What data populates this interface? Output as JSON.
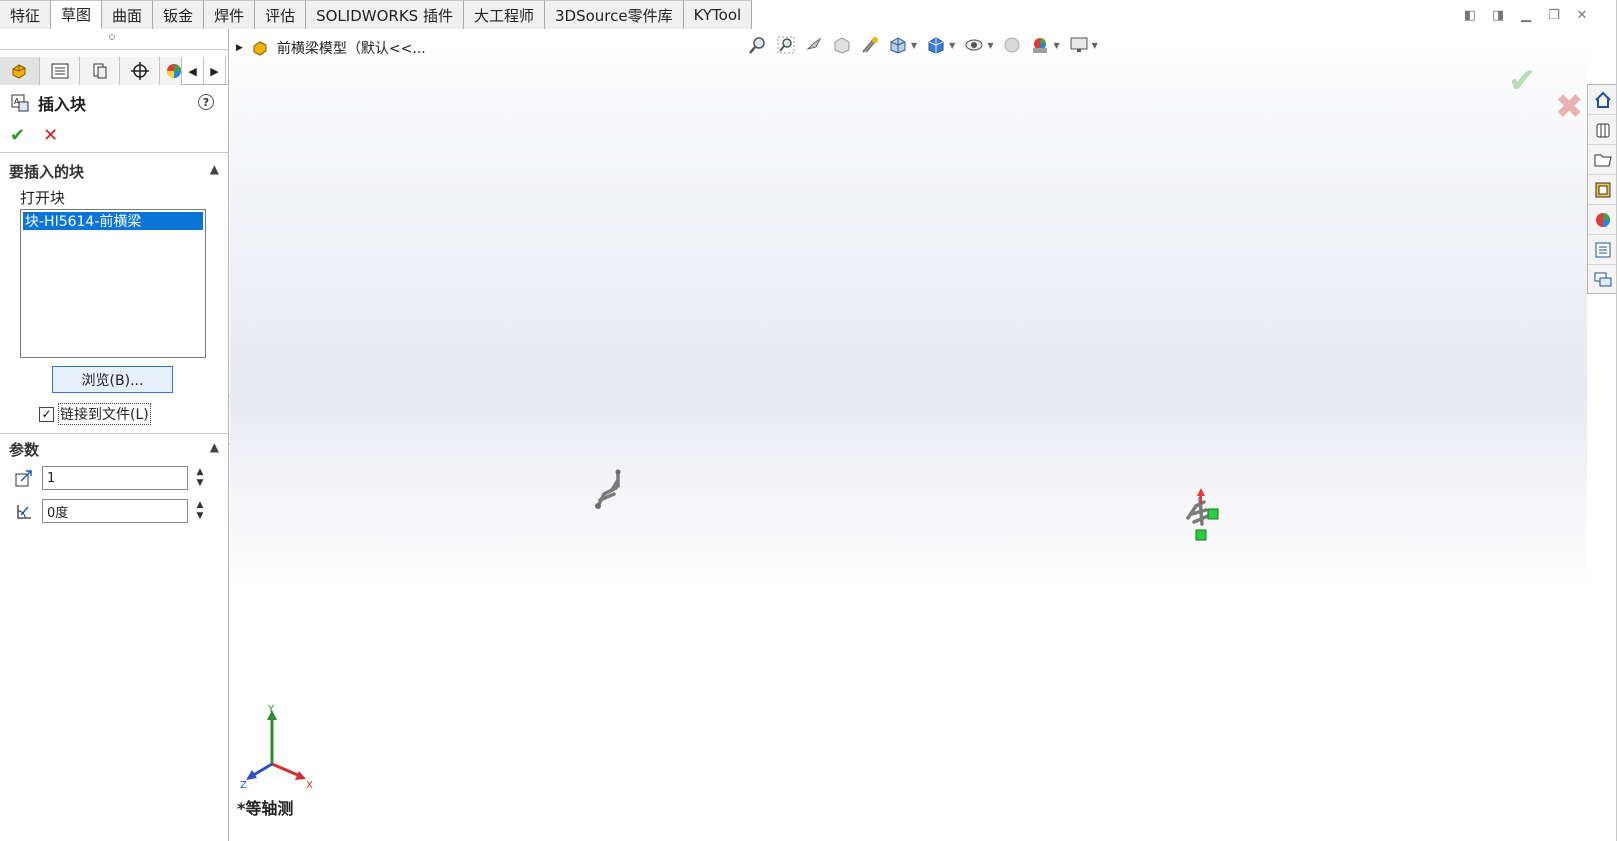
{
  "tabs": [
    {
      "label": "特征",
      "active": false
    },
    {
      "label": "草图",
      "active": true
    },
    {
      "label": "曲面",
      "active": false
    },
    {
      "label": "钣金",
      "active": false
    },
    {
      "label": "焊件",
      "active": false
    },
    {
      "label": "评估",
      "active": false
    },
    {
      "label": "SOLIDWORKS 插件",
      "active": false
    },
    {
      "label": "大工程师",
      "active": false
    },
    {
      "label": "3DSource零件库",
      "active": false
    },
    {
      "label": "KYTool",
      "active": false
    }
  ],
  "property_manager": {
    "title": "插入块",
    "help": "?",
    "ok": "✔",
    "cancel": "✕",
    "blocks_group": {
      "header": "要插入的块",
      "open_blocks_label": "打开块",
      "items": [
        "块-HI5614-前横梁"
      ],
      "browse_button": "浏览(B)...",
      "link_checkbox": {
        "label": "链接到文件(L)",
        "checked": true
      }
    },
    "params_group": {
      "header": "参数",
      "scale": "1",
      "angle": "0度"
    }
  },
  "viewport": {
    "breadcrumb": "前横梁模型（默认<<...",
    "view_label": "*等轴测",
    "triad": {
      "x": "X",
      "y": "Y",
      "z": "Z"
    }
  },
  "colors": {
    "selection": "#0a74d9",
    "ok": "#2a9b2a",
    "cancel": "#d02020"
  }
}
